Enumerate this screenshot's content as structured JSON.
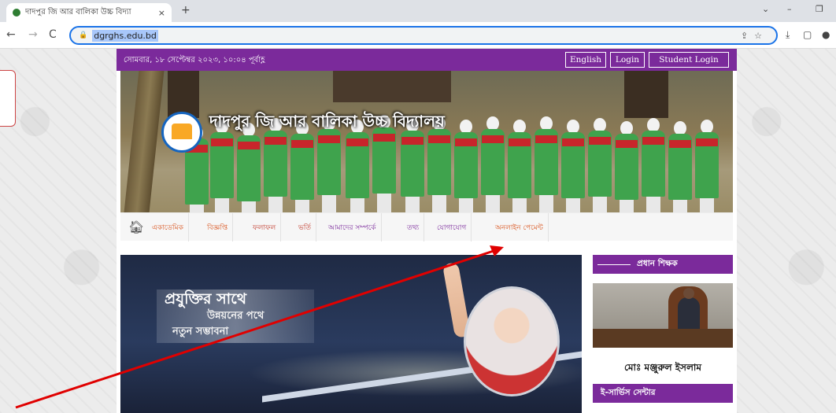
{
  "browser": {
    "tab_title": "দাদপুর জি আর বালিকা উচ্চ বিদ্যা",
    "tab_close": "×",
    "new_tab": "+",
    "url": "dgrghs.edu.bd",
    "nav": {
      "back": "←",
      "forward": "→",
      "reload": "C"
    },
    "window": {
      "chevron": "⌄",
      "minimize": "–",
      "restore": "❐"
    }
  },
  "site": {
    "date_text": "সোমবার, ১৮ সেপ্টেম্বর ২০২৩, ১০:০৪ পূর্বাহ্ণ",
    "top_buttons": [
      "English",
      "Login",
      "Student Login"
    ],
    "school_name": "দাদপুর জি আর বালিকা উচ্চ বিদ্যালয়",
    "nav_items": [
      {
        "label": "একাডেমিক",
        "color": "#d9541e"
      },
      {
        "label": "বিজ্ঞপ্তি",
        "color": "#d9541e"
      },
      {
        "label": "ফলাফল",
        "color": "#c0392b"
      },
      {
        "label": "ভর্তি",
        "color": "#c0392b"
      },
      {
        "label": "আমাদের সম্পর্কে",
        "color": "#7b2a9b"
      },
      {
        "label": "তথ্য",
        "color": "#7b2a9b"
      },
      {
        "label": "যোগাযোগ",
        "color": "#7b2a9b"
      },
      {
        "label": "অনলাইন পেমেন্ট",
        "color": "#d9541e"
      }
    ],
    "slider": {
      "line1": "প্রযুক্তির সাথে",
      "line2": "উন্নয়নের পথে",
      "line3": "নতুন সম্ভাবনা"
    },
    "sidebar": {
      "head_teacher_heading": "প্রধান শিক্ষক",
      "head_teacher_name": "মোঃ মঞ্জুরুল ইসলাম",
      "eservice_heading": "ই-সার্ভিস সেন্টার"
    },
    "colors": {
      "primary": "#7b2a9b",
      "annotation": "#e00000"
    }
  }
}
